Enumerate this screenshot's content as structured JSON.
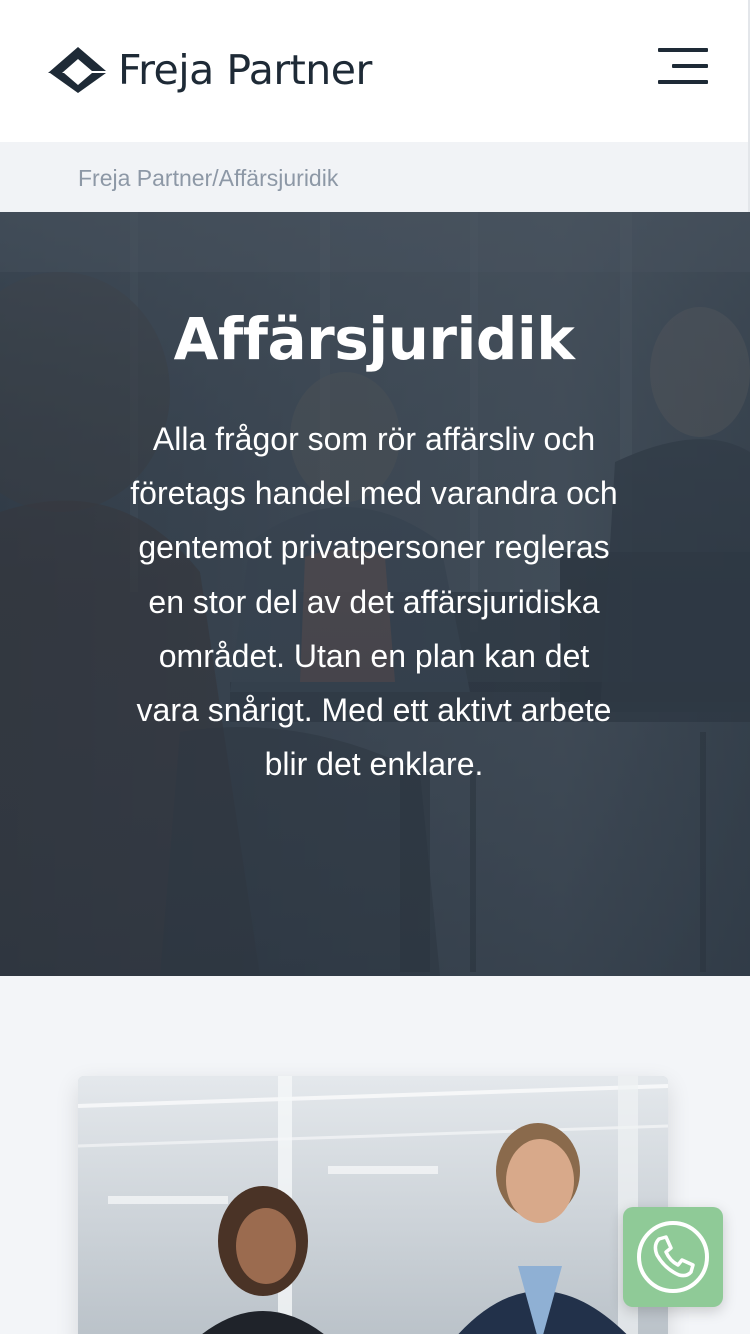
{
  "header": {
    "brand_name": "Freja Partner",
    "logo_icon": "freja-logo-mark",
    "menu_icon": "hamburger-menu-icon"
  },
  "breadcrumb": {
    "path": "Freja Partner/Affärsjuridik"
  },
  "hero": {
    "title": "Affärsjuridik",
    "description": "Alla frågor som rör affärsliv och företags handel med varandra och gentemot privatpersoner regleras en stor del av det affärsjuridiska området. Utan en plan kan det vara snårigt. Med ett aktivt arbete blir det enklare.",
    "background_image": "business-meeting-photo"
  },
  "section": {
    "card_image": "two-colleagues-in-office-photo"
  },
  "call_button": {
    "icon": "phone-icon"
  },
  "colors": {
    "text_dark": "#1e2a36",
    "breadcrumb_text": "#8d98a6",
    "hero_overlay": "#3a4652",
    "page_bg": "#f3f5f8",
    "call_button": "#8fca97"
  }
}
